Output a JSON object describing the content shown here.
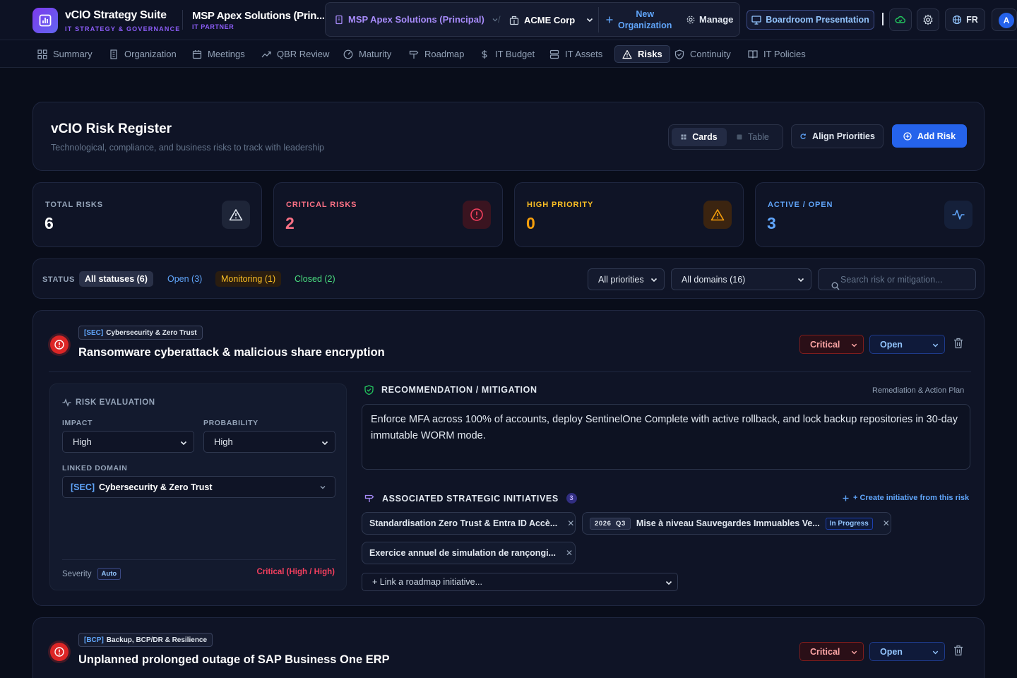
{
  "brand": {
    "title": "vCIO Strategy Suite",
    "subtitle": "IT STRATEGY & GOVERNANCE"
  },
  "org": {
    "title": "MSP Apex Solutions (Prin...",
    "subtitle": "IT PARTNER"
  },
  "switcher": {
    "msp": "MSP Apex Solutions (Principal)",
    "slash": "/",
    "client": "ACME Corp",
    "new_org_line1": "New",
    "new_org_line2": "Organization",
    "manage": "Manage"
  },
  "topbar": {
    "boardroom": "Boardroom Presentation",
    "lang": "FR",
    "avatar": "A"
  },
  "nav": [
    {
      "label": "Summary",
      "icon": "grid-icon"
    },
    {
      "label": "Organization",
      "icon": "building-icon"
    },
    {
      "label": "Meetings",
      "icon": "calendar-icon"
    },
    {
      "label": "QBR Review",
      "icon": "trend-icon"
    },
    {
      "label": "Maturity",
      "icon": "gauge-icon"
    },
    {
      "label": "Roadmap",
      "icon": "signpost-icon"
    },
    {
      "label": "IT Budget",
      "icon": "dollar-icon"
    },
    {
      "label": "IT Assets",
      "icon": "server-icon"
    },
    {
      "label": "Risks",
      "icon": "warning-icon",
      "active": true
    },
    {
      "label": "Continuity",
      "icon": "shield-icon"
    },
    {
      "label": "IT Policies",
      "icon": "book-icon"
    }
  ],
  "register": {
    "title": "vCIO Risk Register",
    "subtitle": "Technological, compliance, and business risks to track with leadership",
    "view_cards": "Cards",
    "view_table": "Table",
    "align": "Align Priorities",
    "add": "Add Risk"
  },
  "stats": [
    {
      "label": "TOTAL RISKS",
      "value": "6",
      "color": "#94a3b8",
      "value_color": "#ffffff",
      "icon": "warning-icon"
    },
    {
      "label": "CRITICAL RISKS",
      "value": "2",
      "color": "#fb7185",
      "value_color": "#fb7185",
      "icon": "alert-circle-icon"
    },
    {
      "label": "HIGH PRIORITY",
      "value": "0",
      "color": "#fbbf24",
      "value_color": "#f59e0b",
      "icon": "warning-icon"
    },
    {
      "label": "ACTIVE / OPEN",
      "value": "3",
      "color": "#60a5fa",
      "value_color": "#60a5fa",
      "icon": "activity-icon"
    }
  ],
  "filters": {
    "status_label": "STATUS",
    "all": "All statuses (6)",
    "open": "Open (3)",
    "monitoring": "Monitoring (1)",
    "closed": "Closed (2)",
    "priorities": "All priorities",
    "domains": "All domains (16)",
    "search_placeholder": "Search risk or mitigation..."
  },
  "risks": [
    {
      "domain_code": "[SEC]",
      "domain_name": "Cybersecurity & Zero Trust",
      "title": "Ransomware cyberattack & malicious share encryption",
      "priority": "Critical",
      "status": "Open",
      "eval_title": "RISK EVALUATION",
      "impact_label": "IMPACT",
      "impact": "High",
      "prob_label": "PROBABILITY",
      "probability": "High",
      "linked_label": "LINKED DOMAIN",
      "severity_label": "Severity",
      "severity_auto": "Auto",
      "severity": "Critical (High / High)",
      "reco_title": "RECOMMENDATION / MITIGATION",
      "reco_tag": "Remediation & Action Plan",
      "recommendation": "Enforce MFA across 100% of accounts, deploy SentinelOne Complete with active rollback, and lock backup repositories in 30-day immutable WORM mode.",
      "assoc_title": "ASSOCIATED STRATEGIC INITIATIVES",
      "assoc_count": "3",
      "create_link": "+ Create initiative from this risk",
      "initiatives": [
        {
          "name": "Standardisation Zero Trust & Entra ID Accè..."
        },
        {
          "year": "2026",
          "quarter": "Q3",
          "name": "Mise à niveau Sauvegardes Immuables Ve...",
          "status": "In Progress"
        },
        {
          "name": "Exercice annuel de simulation de rançongi..."
        }
      ],
      "link_placeholder": "+ Link a roadmap initiative..."
    },
    {
      "domain_code": "[BCP]",
      "domain_name": "Backup, BCP/DR & Resilience",
      "title": "Unplanned prolonged outage of SAP Business One ERP",
      "priority": "Critical",
      "status": "Open"
    }
  ]
}
